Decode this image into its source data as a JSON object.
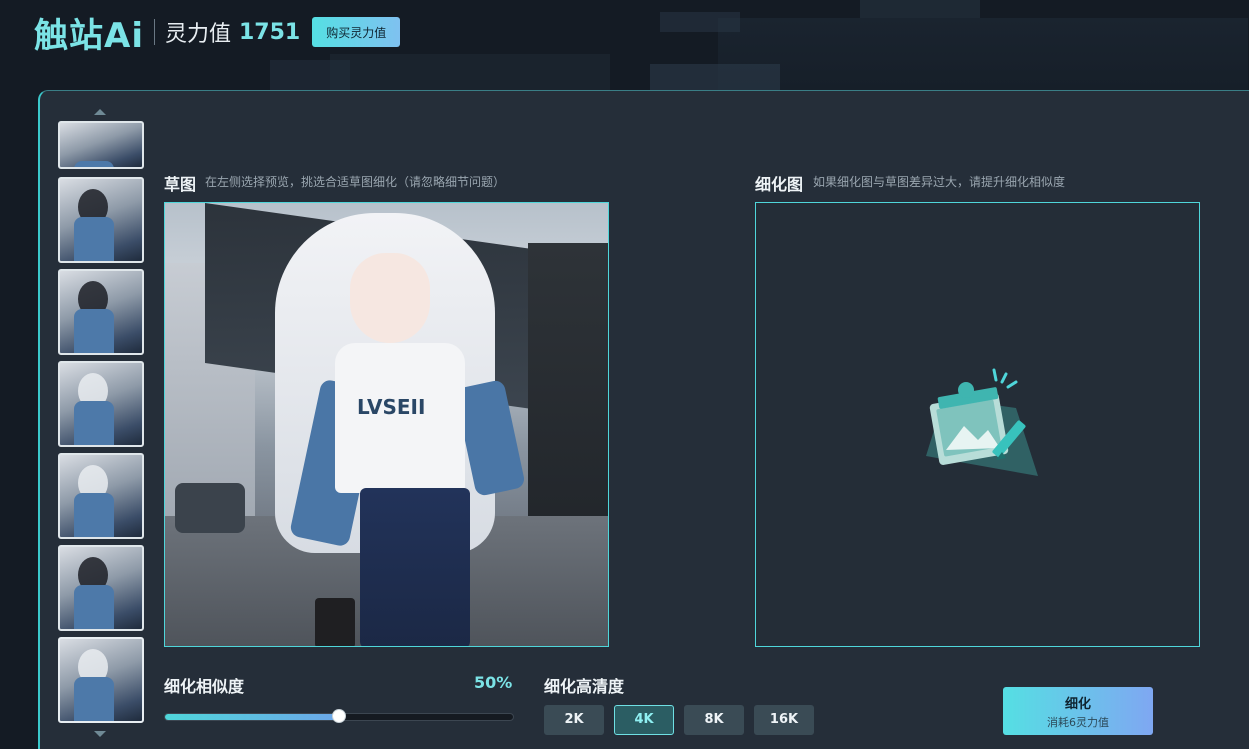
{
  "header": {
    "logo": "触站Ai",
    "power_label": "灵力值",
    "power_value": "1751",
    "buy_button": "购买灵力值"
  },
  "sketch": {
    "title": "草图",
    "hint": "在左侧选择预览，挑选合适草图细化（请忽略细节问题）",
    "shirt_text": "LVSEII"
  },
  "refined": {
    "title": "细化图",
    "hint": "如果细化图与草图差异过大，请提升细化相似度"
  },
  "similarity": {
    "label": "细化相似度",
    "value_text": "50%",
    "value": 0.5
  },
  "resolution": {
    "label": "细化高清度",
    "options": [
      "2K",
      "4K",
      "8K",
      "16K"
    ],
    "selected": "4K"
  },
  "refine_button": {
    "label": "细化",
    "cost": "消耗6灵力值"
  },
  "colors": {
    "accent": "#7be3e6",
    "border": "#4fd6da",
    "panel": "#252e39",
    "background": "#141b24"
  }
}
